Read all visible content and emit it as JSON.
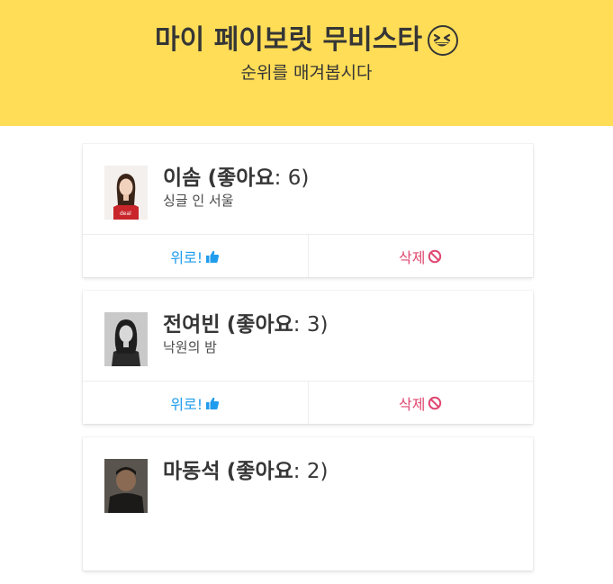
{
  "header": {
    "title": "마이 페이보릿 무비스타",
    "subtitle": "순위를 매겨봅시다",
    "emoji_icon": "grinning-squinting-face-icon"
  },
  "colors": {
    "hero_bg": "#ffdd57",
    "cheer": "#209cee",
    "delete": "#e04870"
  },
  "cards": [
    {
      "name": "이솜",
      "likes_prefix": "(좋아요",
      "likes_value": ": 6)",
      "movie": "싱글 인 서울",
      "cheer_label": "위로!",
      "delete_label": "삭제"
    },
    {
      "name": "전여빈",
      "likes_prefix": "(좋아요",
      "likes_value": ": 3)",
      "movie": "낙원의 밤",
      "cheer_label": "위로!",
      "delete_label": "삭제"
    },
    {
      "name": "마동석",
      "likes_prefix": "(좋아요",
      "likes_value": ": 2)",
      "movie": "",
      "cheer_label": "",
      "delete_label": ""
    }
  ],
  "icons": {
    "cheer": "thumbs-up-icon",
    "delete": "ban-icon"
  }
}
